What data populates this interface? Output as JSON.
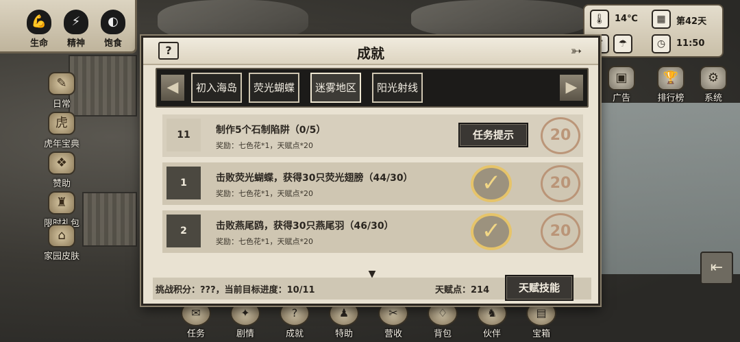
{
  "status": {
    "stats": [
      {
        "label": "生命",
        "icon": "muscle-icon"
      },
      {
        "label": "精神",
        "icon": "brain-lightning-icon"
      },
      {
        "label": "饱食",
        "icon": "stomach-icon"
      }
    ]
  },
  "left_menu": [
    {
      "label": "日常",
      "icon": "quill-icon"
    },
    {
      "label": "虎年宝典",
      "icon": "tiger-icon"
    },
    {
      "label": "赞助",
      "icon": "winged-chest-icon"
    },
    {
      "label": "限时礼包",
      "icon": "gift-bag-icon"
    },
    {
      "label": "家园皮肤",
      "icon": "house-icon"
    }
  ],
  "top_right": {
    "temperature": "14℃",
    "day": "第42天",
    "time": "11:50"
  },
  "right_menu": [
    {
      "label": "广告",
      "icon": "ad-chest-icon"
    },
    {
      "label": "排行榜",
      "icon": "trophy-icon"
    },
    {
      "label": "系统",
      "icon": "gear-icon"
    }
  ],
  "dialog": {
    "title": "成就",
    "help": "?",
    "tabs": [
      {
        "label": "初入海岛",
        "active": false
      },
      {
        "label": "荧光蝴蝶",
        "active": false
      },
      {
        "label": "迷雾地区",
        "active": true
      },
      {
        "label": "阳光射线",
        "active": false
      }
    ],
    "rows": [
      {
        "num": "11",
        "title": "制作5个石制陷阱（0/5）",
        "reward": "奖励：七色花*1，天赋点*20",
        "status": "in-progress",
        "button": "任务提示",
        "points": "20"
      },
      {
        "num": "1",
        "title": "击败荧光蝴蝶，获得30只荧光翅膀（44/30）",
        "reward": "奖励：七色花*1，天赋点*20",
        "status": "completed",
        "points": "20"
      },
      {
        "num": "2",
        "title": "击败燕尾鸥，获得30只燕尾羽（46/30）",
        "reward": "奖励：七色花*1，天赋点*20",
        "status": "completed",
        "points": "20"
      }
    ],
    "footer": {
      "progress": "挑战积分：???，当前目标进度：10/11",
      "talent": "天赋点：214",
      "talent_button": "天赋技能"
    }
  },
  "bottom_nav": [
    {
      "label": "任务",
      "icon": "quest-icon"
    },
    {
      "label": "剧情",
      "icon": "story-icon"
    },
    {
      "label": "成就",
      "icon": "achievement-icon"
    },
    {
      "label": "特助",
      "icon": "helper-icon"
    },
    {
      "label": "营收",
      "icon": "revenue-icon"
    },
    {
      "label": "背包",
      "icon": "backpack-icon"
    },
    {
      "label": "伙伴",
      "icon": "companion-icon"
    },
    {
      "label": "宝箱",
      "icon": "treasure-chest-icon"
    }
  ]
}
